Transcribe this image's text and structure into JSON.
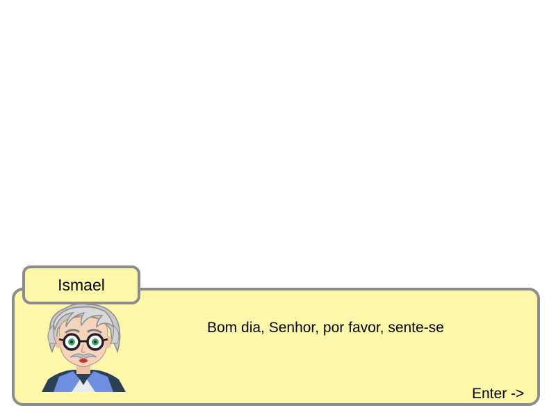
{
  "dialog": {
    "speaker_name": "Ismael",
    "text": "Bom dia, Senhor, por favor, sente-se",
    "continue_prompt": "Enter ->",
    "portrait_icon": "elderly-scientist-portrait-icon"
  },
  "colors": {
    "box_fill": "#fff8ab",
    "box_border": "#8c8c8c",
    "text": "#000000"
  }
}
